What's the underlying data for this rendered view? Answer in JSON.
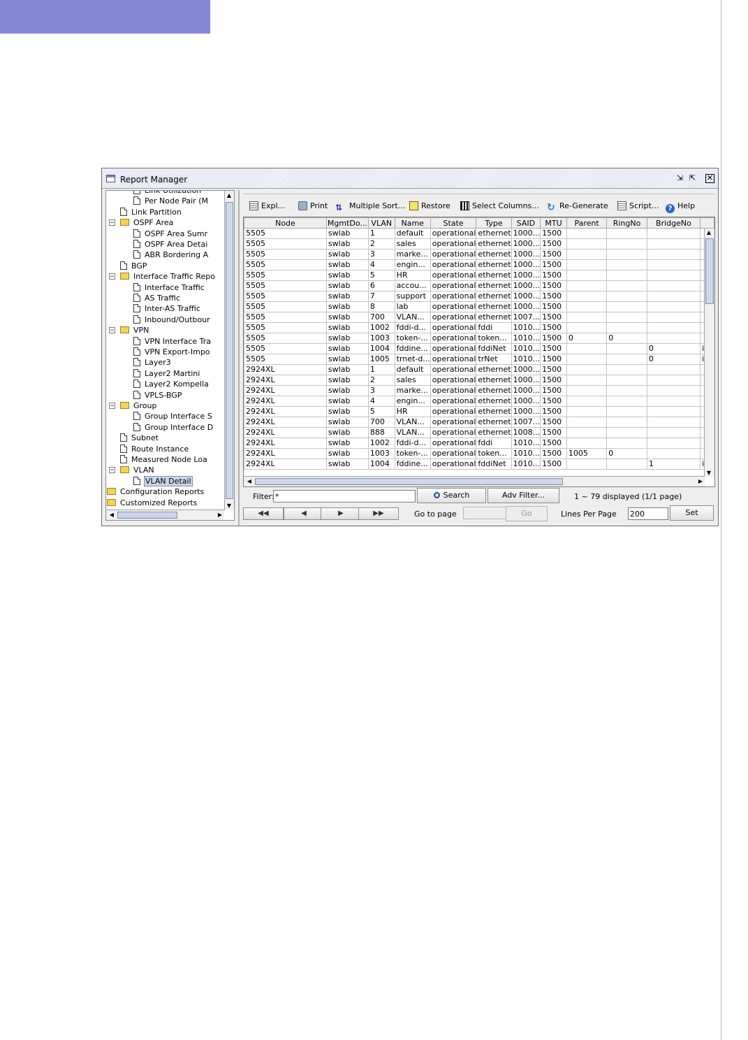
{
  "window": {
    "title": "Report Manager",
    "buttons": {
      "minimize": "⇲",
      "maximize": "⇱",
      "close": "✕"
    }
  },
  "tree": {
    "items": [
      {
        "label": "Link Utilization",
        "icon": "doc-icon"
      },
      {
        "label": "Per Node Pair (M",
        "icon": "doc-icon"
      },
      {
        "label": "Link Partition",
        "icon": "doc-icon"
      },
      {
        "label": "OSPF Area",
        "icon": "folder-icon"
      },
      {
        "label": "OSPF Area Sumr",
        "icon": "doc-icon"
      },
      {
        "label": "OSPF Area Detai",
        "icon": "doc-icon"
      },
      {
        "label": "ABR Bordering A",
        "icon": "doc-icon"
      },
      {
        "label": "BGP",
        "icon": "doc-icon"
      },
      {
        "label": "Interface Traffic Repo",
        "icon": "folder-icon"
      },
      {
        "label": "Interface Traffic",
        "icon": "doc-icon"
      },
      {
        "label": "AS Traffic",
        "icon": "doc-icon"
      },
      {
        "label": "Inter-AS Traffic",
        "icon": "doc-icon"
      },
      {
        "label": "Inbound/Outbour",
        "icon": "doc-icon"
      },
      {
        "label": "VPN",
        "icon": "folder-icon"
      },
      {
        "label": "VPN Interface Tra",
        "icon": "doc-icon"
      },
      {
        "label": "VPN Export-Impo",
        "icon": "doc-icon"
      },
      {
        "label": "Layer3",
        "icon": "doc-icon"
      },
      {
        "label": "Layer2 Martini",
        "icon": "doc-icon"
      },
      {
        "label": "Layer2 Kompella",
        "icon": "doc-icon"
      },
      {
        "label": "VPLS-BGP",
        "icon": "doc-icon"
      },
      {
        "label": "Group",
        "icon": "folder-icon"
      },
      {
        "label": "Group Interface S",
        "icon": "doc-icon"
      },
      {
        "label": "Group Interface D",
        "icon": "doc-icon"
      },
      {
        "label": "Subnet",
        "icon": "doc-icon"
      },
      {
        "label": "Route Instance",
        "icon": "doc-icon"
      },
      {
        "label": "Measured Node Loa",
        "icon": "doc-icon"
      },
      {
        "label": "VLAN",
        "icon": "folder-icon"
      },
      {
        "label": "VLAN Detail",
        "icon": "doc-icon",
        "selected": true
      },
      {
        "label": "Configuration Reports",
        "icon": "folder-icon"
      },
      {
        "label": "Customized Reports",
        "icon": "folder-icon"
      }
    ]
  },
  "toolbar": {
    "explore": "Expl...",
    "print": "Print",
    "multiple_sort": "Multiple Sort...",
    "restore": "Restore",
    "select_columns": "Select Columns...",
    "regenerate": "Re-Generate",
    "script": "Script...",
    "help": "Help"
  },
  "table": {
    "columns": [
      "Node",
      "MgmtDo...",
      "VLAN",
      "Name",
      "State",
      "Type",
      "SAID",
      "MTU",
      "Parent",
      "RingNo",
      "BridgeNo",
      ""
    ],
    "rows": [
      [
        "5505",
        "swlab",
        "1",
        "default",
        "operational",
        "ethernet",
        "1000...",
        "1500",
        "",
        "",
        "",
        ""
      ],
      [
        "5505",
        "swlab",
        "2",
        "sales",
        "operational",
        "ethernet",
        "1000...",
        "1500",
        "",
        "",
        "",
        ""
      ],
      [
        "5505",
        "swlab",
        "3",
        "marke...",
        "operational",
        "ethernet",
        "1000...",
        "1500",
        "",
        "",
        "",
        ""
      ],
      [
        "5505",
        "swlab",
        "4",
        "engin...",
        "operational",
        "ethernet",
        "1000...",
        "1500",
        "",
        "",
        "",
        ""
      ],
      [
        "5505",
        "swlab",
        "5",
        "HR",
        "operational",
        "ethernet",
        "1000...",
        "1500",
        "",
        "",
        "",
        ""
      ],
      [
        "5505",
        "swlab",
        "6",
        "accou...",
        "operational",
        "ethernet",
        "1000...",
        "1500",
        "",
        "",
        "",
        ""
      ],
      [
        "5505",
        "swlab",
        "7",
        "support",
        "operational",
        "ethernet",
        "1000...",
        "1500",
        "",
        "",
        "",
        ""
      ],
      [
        "5505",
        "swlab",
        "8",
        "lab",
        "operational",
        "ethernet",
        "1000...",
        "1500",
        "",
        "",
        "",
        ""
      ],
      [
        "5505",
        "swlab",
        "700",
        "VLAN...",
        "operational",
        "ethernet",
        "1007...",
        "1500",
        "",
        "",
        "",
        ""
      ],
      [
        "5505",
        "swlab",
        "1002",
        "fddi-d...",
        "operational",
        "fddi",
        "1010...",
        "1500",
        "",
        "",
        "",
        ""
      ],
      [
        "5505",
        "swlab",
        "1003",
        "token-...",
        "operational",
        "token...",
        "1010...",
        "1500",
        "0",
        "0",
        "",
        ""
      ],
      [
        "5505",
        "swlab",
        "1004",
        "fddine...",
        "operational",
        "fddiNet",
        "1010...",
        "1500",
        "",
        "",
        "0",
        "ie"
      ],
      [
        "5505",
        "swlab",
        "1005",
        "trnet-d...",
        "operational",
        "trNet",
        "1010...",
        "1500",
        "",
        "",
        "0",
        "ib"
      ],
      [
        "2924XL",
        "swlab",
        "1",
        "default",
        "operational",
        "ethernet",
        "1000...",
        "1500",
        "",
        "",
        "",
        ""
      ],
      [
        "2924XL",
        "swlab",
        "2",
        "sales",
        "operational",
        "ethernet",
        "1000...",
        "1500",
        "",
        "",
        "",
        ""
      ],
      [
        "2924XL",
        "swlab",
        "3",
        "marke...",
        "operational",
        "ethernet",
        "1000...",
        "1500",
        "",
        "",
        "",
        ""
      ],
      [
        "2924XL",
        "swlab",
        "4",
        "engin...",
        "operational",
        "ethernet",
        "1000...",
        "1500",
        "",
        "",
        "",
        ""
      ],
      [
        "2924XL",
        "swlab",
        "5",
        "HR",
        "operational",
        "ethernet",
        "1000...",
        "1500",
        "",
        "",
        "",
        ""
      ],
      [
        "2924XL",
        "swlab",
        "700",
        "VLAN...",
        "operational",
        "ethernet",
        "1007...",
        "1500",
        "",
        "",
        "",
        ""
      ],
      [
        "2924XL",
        "swlab",
        "888",
        "VLAN...",
        "operational",
        "ethernet",
        "1008...",
        "1500",
        "",
        "",
        "",
        ""
      ],
      [
        "2924XL",
        "swlab",
        "1002",
        "fddi-d...",
        "operational",
        "fddi",
        "1010...",
        "1500",
        "",
        "",
        "",
        ""
      ],
      [
        "2924XL",
        "swlab",
        "1003",
        "token-...",
        "operational",
        "token...",
        "1010...",
        "1500",
        "1005",
        "0",
        "",
        ""
      ],
      [
        "2924XL",
        "swlab",
        "1004",
        "fddine...",
        "operational",
        "fddiNet",
        "1010...",
        "1500",
        "",
        "",
        "1",
        "ib"
      ]
    ]
  },
  "filter": {
    "label": "Filter:",
    "value": "*"
  },
  "buttons": {
    "search": "Search",
    "adv_filter": "Adv Filter...",
    "go": "Go",
    "set": "Set"
  },
  "status": {
    "displayed": "1 ~ 79 displayed (1/1 page)"
  },
  "paging": {
    "first": "◀◀",
    "prev": "◀",
    "next": "▶",
    "last": "▶▶",
    "goto_label": "Go to page",
    "goto_value": "",
    "lines_label": "Lines Per Page",
    "lines_value": "200"
  },
  "colors": {
    "top_band": "#8585d6",
    "selection": "#c9d6ec",
    "scroll_thumb": "#b7c6e0"
  }
}
